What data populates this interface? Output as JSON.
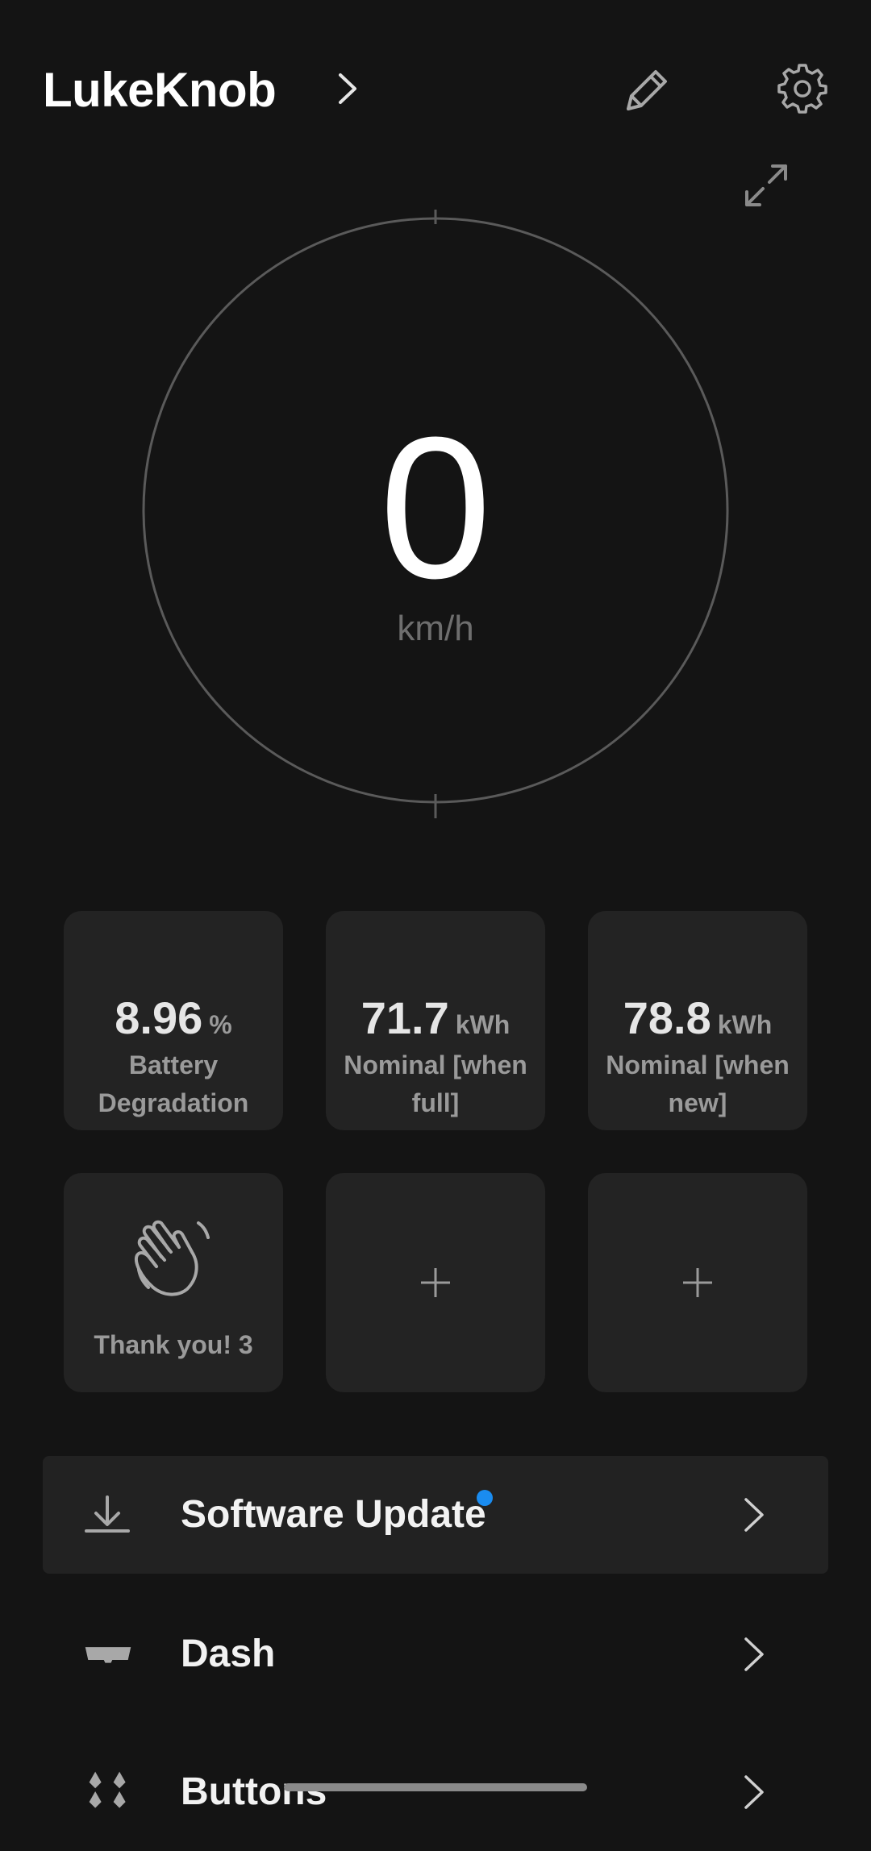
{
  "header": {
    "title": "LukeKnob"
  },
  "gauge": {
    "value": "0",
    "unit": "km/h"
  },
  "tiles": [
    {
      "value": "8.96",
      "unit": "%",
      "label": "Battery Degradation"
    },
    {
      "value": "71.7",
      "unit": "kWh",
      "label": "Nominal [when full]"
    },
    {
      "value": "78.8",
      "unit": "kWh",
      "label": "Nominal [when new]"
    },
    {
      "label": "Thank you! 3",
      "icon": "waving-hand-icon"
    },
    {
      "icon": "plus-icon"
    },
    {
      "icon": "plus-icon"
    }
  ],
  "menu": [
    {
      "label": "Software Update",
      "icon": "download-icon",
      "badge": true
    },
    {
      "label": "Dash",
      "icon": "dash-icon"
    },
    {
      "label": "Buttons",
      "icon": "buttons-icon"
    }
  ],
  "colors": {
    "background": "#141414",
    "tile": "#232323",
    "badge": "#1a8cf0",
    "gauge_ring": "#5a5a5a"
  }
}
